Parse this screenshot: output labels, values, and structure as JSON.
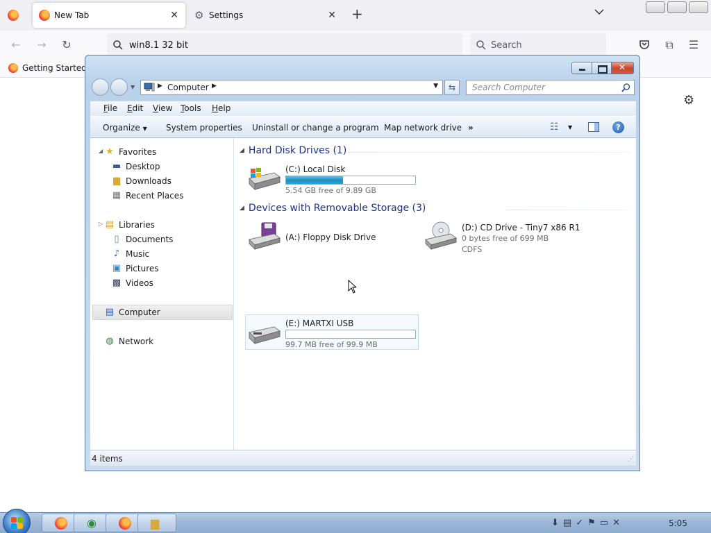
{
  "browser": {
    "tabs": [
      {
        "label": "New Tab",
        "active": true
      },
      {
        "label": "Settings",
        "active": false
      }
    ],
    "url_value": "win8.1 32 bit",
    "search_placeholder": "Search",
    "bookmarks": [
      {
        "label": "Getting Started"
      }
    ]
  },
  "explorer": {
    "address": "Computer",
    "search_placeholder": "Search Computer",
    "menu": [
      "File",
      "Edit",
      "View",
      "Tools",
      "Help"
    ],
    "commands": [
      "Organize",
      "System properties",
      "Uninstall or change a program",
      "Map network drive"
    ],
    "more_glyph": "»",
    "nav": {
      "favorites": {
        "label": "Favorites",
        "items": [
          "Desktop",
          "Downloads",
          "Recent Places"
        ]
      },
      "libraries": {
        "label": "Libraries",
        "items": [
          "Documents",
          "Music",
          "Pictures",
          "Videos"
        ]
      },
      "computer": "Computer",
      "network": "Network"
    },
    "groups": {
      "hdd": {
        "title": "Hard Disk Drives (1)",
        "drives": [
          {
            "name": "(C:) Local Disk",
            "free": "5.54 GB free of 9.89 GB",
            "used_fraction": 0.44
          }
        ]
      },
      "removable": {
        "title": "Devices with Removable Storage (3)",
        "floppy": {
          "name": "(A:) Floppy Disk Drive"
        },
        "cd": {
          "name": "(D:) CD Drive - Tiny7 x86 R1",
          "free": "0 bytes free of 699 MB",
          "fs": "CDFS"
        },
        "usb": {
          "name": "(E:) MARTXI USB",
          "free": "99.7 MB free of 99.9 MB",
          "used_fraction": 0.002
        }
      }
    },
    "status": "4 items"
  },
  "taskbar": {
    "clock": "5:05",
    "colors": {
      "bar_top": "#b9cee6",
      "bar_bottom": "#8eaacd"
    }
  },
  "colors": {
    "group_title": "#1e3287",
    "progress": "#1f8fc4",
    "close_button": "#c9462c"
  }
}
